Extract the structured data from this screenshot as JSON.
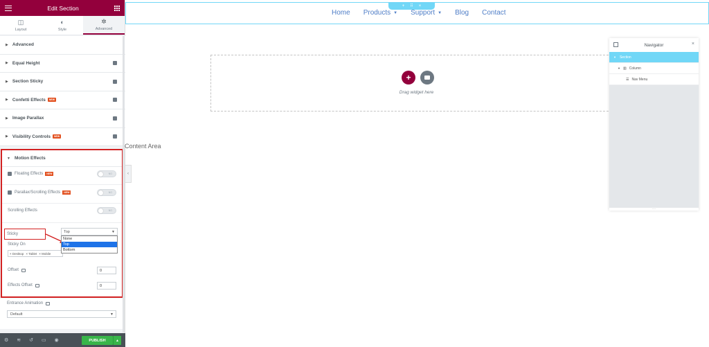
{
  "panel": {
    "title": "Edit Section",
    "tabs": [
      {
        "label": "Layout",
        "icon": "layout-icon"
      },
      {
        "label": "Style",
        "icon": "style-icon"
      },
      {
        "label": "Advanced",
        "icon": "gear-icon"
      }
    ],
    "sections": [
      {
        "label": "Advanced",
        "badge": "",
        "pro": false
      },
      {
        "label": "Equal Height",
        "badge": "",
        "pro": true
      },
      {
        "label": "Section Sticky",
        "badge": "",
        "pro": true
      },
      {
        "label": "Confetti Effects",
        "badge": "NEW",
        "pro": true
      },
      {
        "label": "Image Parallax",
        "badge": "",
        "pro": true
      },
      {
        "label": "Visibility Controls",
        "badge": "NEW",
        "pro": true
      }
    ],
    "motion": {
      "label": "Motion Effects",
      "floating": {
        "label": "Floating Effects",
        "badge": "NEW",
        "toggle": "NO"
      },
      "parallax": {
        "label": "Parallax/Scrolling Effects",
        "badge": "NEW",
        "toggle": "NO"
      },
      "scrolling": {
        "label": "Scrolling Effects",
        "toggle": "NO"
      },
      "sticky": {
        "label": "Sticky",
        "value": "Top",
        "options": [
          "None",
          "Top",
          "Bottom"
        ],
        "selected_index": 1
      },
      "sticky_on": {
        "label": "Sticky On",
        "devices": [
          "Desktop",
          "Tablet",
          "Mobile"
        ]
      },
      "offset": {
        "label": "Offset",
        "value": "0"
      },
      "effects_offset": {
        "label": "Effects Offset",
        "value": "0"
      }
    },
    "entrance": {
      "label": "Entrance Animation",
      "value": "Default"
    },
    "footer": {
      "publish": "PUBLISH"
    }
  },
  "canvas": {
    "menu": [
      {
        "label": "Home",
        "dropdown": false
      },
      {
        "label": "Products",
        "dropdown": true
      },
      {
        "label": "Support",
        "dropdown": true
      },
      {
        "label": "Blog",
        "dropdown": false
      },
      {
        "label": "Contact",
        "dropdown": false
      }
    ],
    "drag_text": "Drag widget here",
    "content_area": "Content Area"
  },
  "navigator": {
    "title": "Navigator",
    "items": [
      {
        "label": "Section",
        "level": 0,
        "active": true
      },
      {
        "label": "Column",
        "level": 1,
        "active": false
      },
      {
        "label": "Nav Menu",
        "level": 2,
        "active": false
      }
    ]
  },
  "colors": {
    "brand": "#93003c",
    "accent_blue": "#71d7f7",
    "publish": "#39b54a",
    "highlight_red": "#d32121",
    "menu_link": "#4f7ec7"
  }
}
